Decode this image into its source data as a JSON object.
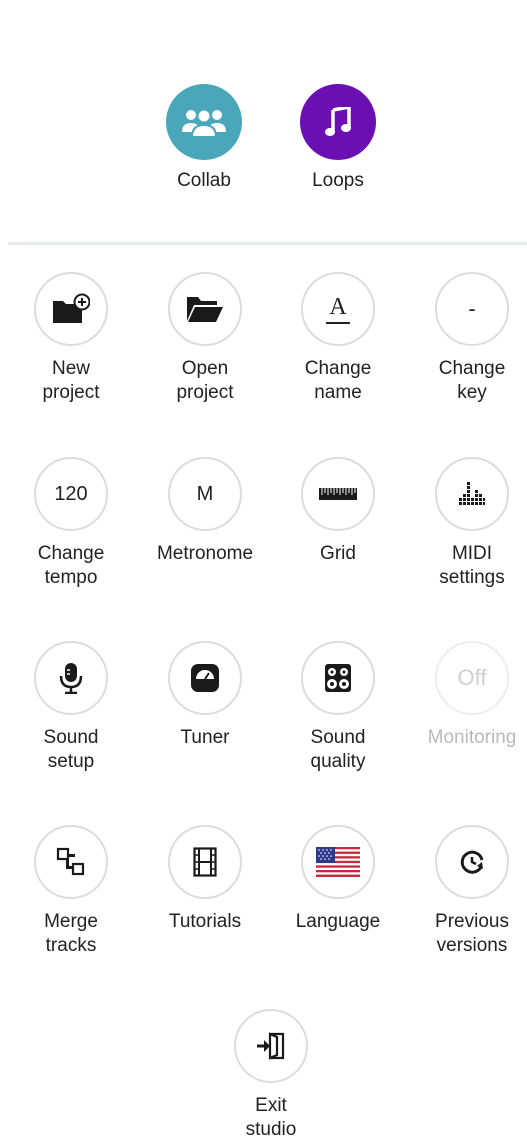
{
  "top": {
    "collab": {
      "label": "Collab",
      "icon": "collab-icon",
      "color": "#4aa7b9"
    },
    "loops": {
      "label": "Loops",
      "icon": "music-note-icon",
      "color": "#6a0fb1"
    }
  },
  "menu": {
    "new_project": {
      "label": "New\nproject",
      "icon": "new-folder-icon"
    },
    "open_project": {
      "label": "Open\nproject",
      "icon": "open-folder-icon"
    },
    "change_name": {
      "label": "Change\nname",
      "icon_text": "A"
    },
    "change_key": {
      "label": "Change\nkey",
      "icon_text": "-"
    },
    "change_tempo": {
      "label": "Change\ntempo",
      "icon_text": "120"
    },
    "metronome": {
      "label": "Metronome",
      "icon_text": "M"
    },
    "grid": {
      "label": "Grid",
      "icon": "ruler-icon"
    },
    "midi_settings": {
      "label": "MIDI\nsettings",
      "icon": "equalizer-icon"
    },
    "sound_setup": {
      "label": "Sound\nsetup",
      "icon": "microphone-icon"
    },
    "tuner": {
      "label": "Tuner",
      "icon": "tuner-icon"
    },
    "sound_quality": {
      "label": "Sound\nquality",
      "icon": "speaker-icon"
    },
    "monitoring": {
      "label": "Monitoring",
      "icon_text": "Off",
      "enabled": false
    },
    "merge_tracks": {
      "label": "Merge\ntracks",
      "icon": "merge-icon"
    },
    "tutorials": {
      "label": "Tutorials",
      "icon": "film-icon"
    },
    "language": {
      "label": "Language",
      "icon": "us-flag-icon"
    },
    "previous_versions": {
      "label": "Previous\nversions",
      "icon": "history-icon"
    },
    "exit_studio": {
      "label": "Exit\nstudio",
      "icon": "exit-icon"
    }
  }
}
